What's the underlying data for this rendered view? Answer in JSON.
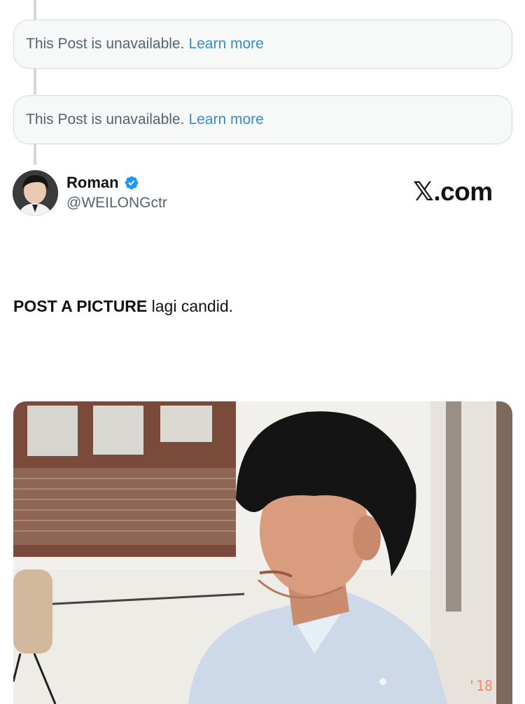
{
  "thread": {
    "unavailable_posts": [
      {
        "message": "This Post is unavailable.",
        "link": "Learn more"
      },
      {
        "message": "This Post is unavailable.",
        "link": "Learn more"
      }
    ]
  },
  "post": {
    "author": {
      "name": "Roman",
      "handle": "@WEILONGctr",
      "verified": true
    },
    "brand": {
      "x_glyph": "𝕏",
      "domain": ".com"
    },
    "text": {
      "emphasis": "POST A PICTURE",
      "rest": " lagi candid."
    },
    "photo": {
      "date_stamp": "'18"
    }
  },
  "colors": {
    "link": "#3a8cc9",
    "verified": "#1d9bf0",
    "muted": "#536471",
    "border": "#cfd9de"
  },
  "icons": {
    "verified": "verified-badge-icon"
  }
}
